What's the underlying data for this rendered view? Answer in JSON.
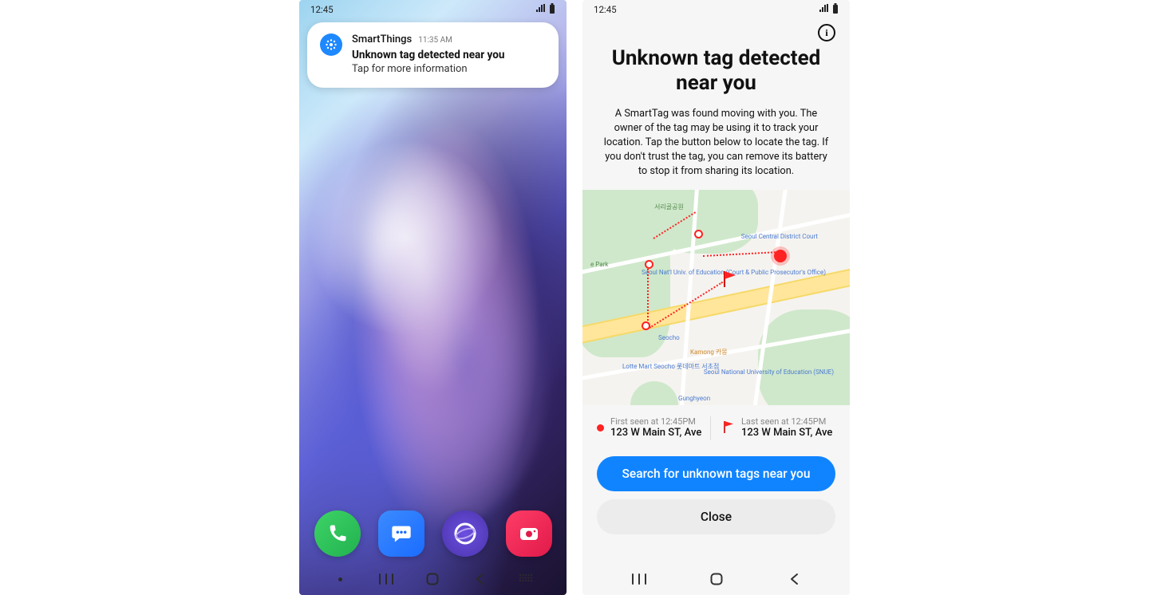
{
  "status": {
    "time": "12:45"
  },
  "home": {
    "notification": {
      "app": "SmartThings",
      "time": "11:35 AM",
      "title": "Unknown tag detected near you",
      "message": "Tap for more information"
    }
  },
  "detail": {
    "title": "Unknown tag detected near you",
    "description": "A SmartTag was found moving with you. The owner of the tag may be using it to track your location. Tap the button below to locate the tag. If you don't trust the tag, you can remove its battery to stop it from sharing its location.",
    "map": {
      "labels": {
        "park_name": "서리골공원",
        "court": "Seoul Central District Court",
        "univ_court": "Seoul Nat'l Univ. of Education (Court & Public Prosecutor's Office)",
        "park_west": "e Park",
        "seocho": "Seocho",
        "kamong": "Kamong 카몽",
        "lotte": "Lotte Mart Seocho 롯데마트 서초점",
        "snue": "Seoul National University of Education (SNUE)",
        "gunghyeon": "Gunghyeon"
      }
    },
    "first_seen": {
      "label": "First seen at 12:45PM",
      "address": "123 W Main ST, Ave"
    },
    "last_seen": {
      "label": "Last seen at 12:45PM",
      "address": "123 W Main ST, Ave"
    },
    "search_button": "Search for unknown tags near you",
    "close_button": "Close"
  }
}
